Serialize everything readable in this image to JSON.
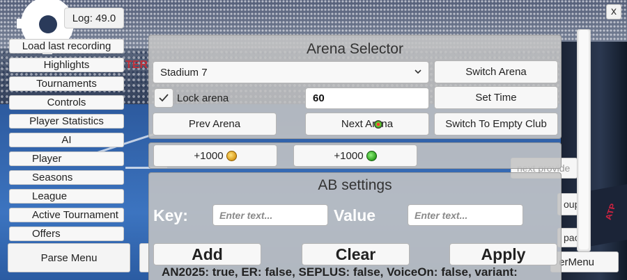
{
  "log": {
    "label": "Log: 49.0"
  },
  "menu": {
    "items": [
      {
        "label": "Load last recording"
      },
      {
        "label": "Highlights"
      },
      {
        "label": "Tournaments"
      },
      {
        "label": "Controls"
      },
      {
        "label": "Player Statistics"
      },
      {
        "label": "AI"
      },
      {
        "label": "Player"
      },
      {
        "label": "Seasons"
      },
      {
        "label": "League"
      },
      {
        "label": "Active Tournament"
      },
      {
        "label": "Offers"
      }
    ],
    "parse_label": "Parse Menu"
  },
  "arena_selector": {
    "title": "Arena Selector",
    "dropdown_value": "Stadium 7",
    "switch_arena_label": "Switch Arena",
    "lock_arena_label": "Lock arena",
    "lock_arena_checked": true,
    "time_value": "60",
    "set_time_label": "Set Time",
    "prev_arena_label": "Prev Arena",
    "next_arena_label": "Next Arena",
    "switch_empty_label": "Switch To Empty Club"
  },
  "currency": {
    "coins_label": "+1000",
    "coins_icon": "gold-coin-icon",
    "gems_label": "+1000",
    "gems_icon": "green-gem-icon"
  },
  "ab_settings": {
    "title": "AB settings",
    "key_label": "Key:",
    "key_placeholder": "Enter text...",
    "value_label": "Value",
    "value_placeholder": "Enter text...",
    "add_label": "Add",
    "clear_label": "Clear",
    "apply_label": "Apply",
    "flags_text": "AN2025: true, ER: false, SEPLUS: false, VoiceOn: false, variant:"
  },
  "right_side": {
    "close_label": "x",
    "peek_1": "next provide",
    "peek_2": "oup",
    "peek_3": "pace",
    "user_menu_label": "erMenu"
  },
  "background": {
    "banner_text": "TER"
  }
}
